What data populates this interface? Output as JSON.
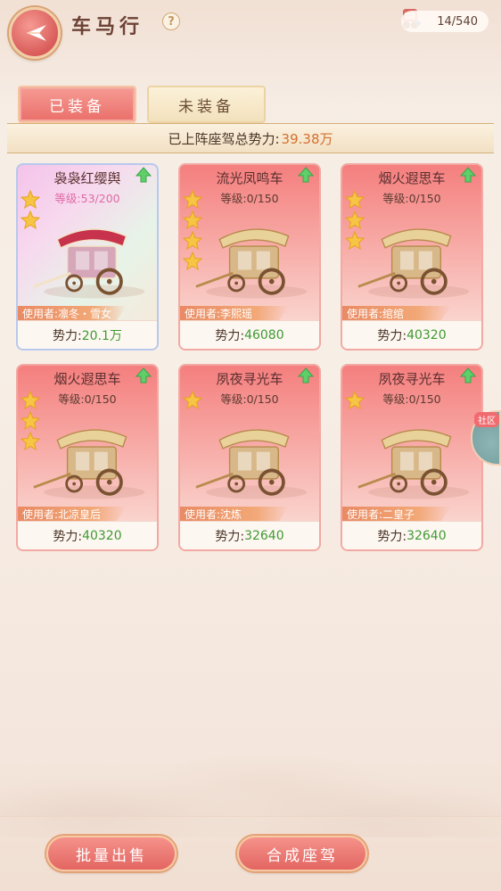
{
  "header": {
    "title": "车马行",
    "help_symbol": "?",
    "counter": "14/540"
  },
  "tabs": [
    {
      "label": "已装备",
      "active": true
    },
    {
      "label": "未装备",
      "active": false
    }
  ],
  "summary": {
    "label": "已上阵座驾总势力:",
    "value": "39.38万"
  },
  "cards": [
    {
      "name": "袅袅红缨舆",
      "level": "等级:53/200",
      "stars": 2,
      "user": "使用者:凛冬・雪女",
      "power_label": "势力:",
      "power": "20.1万",
      "special": true,
      "upgrade": true
    },
    {
      "name": "流光凤鸣车",
      "level": "等级:0/150",
      "stars": 4,
      "user": "使用者:李熙瑶",
      "power_label": "势力:",
      "power": "46080",
      "special": false,
      "upgrade": true
    },
    {
      "name": "烟火遐思车",
      "level": "等级:0/150",
      "stars": 3,
      "user": "使用者:绾绾",
      "power_label": "势力:",
      "power": "40320",
      "special": false,
      "upgrade": true
    },
    {
      "name": "烟火遐思车",
      "level": "等级:0/150",
      "stars": 3,
      "user": "使用者:北凉皇后",
      "power_label": "势力:",
      "power": "40320",
      "special": false,
      "upgrade": true
    },
    {
      "name": "夙夜寻光车",
      "level": "等级:0/150",
      "stars": 1,
      "user": "使用者:沈炼",
      "power_label": "势力:",
      "power": "32640",
      "special": false,
      "upgrade": true
    },
    {
      "name": "夙夜寻光车",
      "level": "等级:0/150",
      "stars": 1,
      "user": "使用者:二皇子",
      "power_label": "势力:",
      "power": "32640",
      "special": false,
      "upgrade": true
    }
  ],
  "side_tab": {
    "label": "社区"
  },
  "buttons": {
    "batch_sell": "批量出售",
    "compose": "合成座驾"
  },
  "colors": {
    "accent": "#e86c68",
    "power_value": "#3f9a33",
    "summary_value": "#d4702f"
  },
  "icons": {
    "back": "back-arrow-icon",
    "help": "help-icon",
    "counter": "carriage-counter-icon",
    "upgrade": "upgrade-arrow-icon",
    "star": "star-icon"
  }
}
